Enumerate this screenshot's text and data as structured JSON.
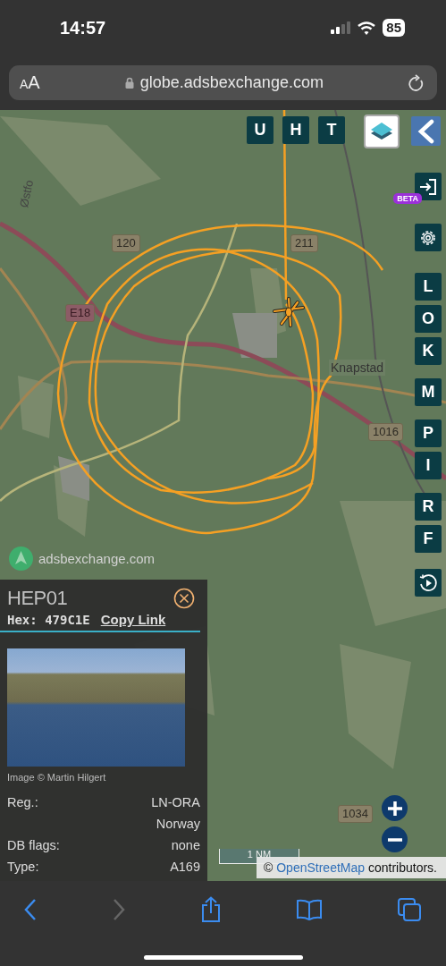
{
  "status_bar": {
    "time": "14:57",
    "battery": "85"
  },
  "browser": {
    "text_size_label": "AA",
    "url": "globe.adsbexchange.com"
  },
  "map": {
    "labels": [
      {
        "kind": "shield",
        "text": "120"
      },
      {
        "kind": "shield",
        "text": "211"
      },
      {
        "kind": "motorway",
        "text": "E18"
      },
      {
        "kind": "place",
        "text": "Knapstad"
      },
      {
        "kind": "shield",
        "text": "1016"
      },
      {
        "kind": "shield",
        "text": "1034"
      },
      {
        "kind": "vertical",
        "text": "Østfo"
      }
    ],
    "brand": "adsbexchange.com",
    "top_buttons": [
      "U",
      "H",
      "T"
    ],
    "beta_badge": "BETA",
    "side_button_groups": [
      [
        "L",
        "O",
        "K"
      ],
      [
        "M"
      ],
      [
        "P",
        "I"
      ],
      [
        "R",
        "F"
      ]
    ],
    "scale": "1 NM",
    "attribution": {
      "prefix": "©",
      "link": "OpenStreetMap",
      "suffix": "contributors."
    }
  },
  "aircraft_panel": {
    "callsign": "HEP01",
    "hex_label": "Hex:",
    "hex": "479C1E",
    "copy_link": "Copy Link",
    "photo_credit": "Image © Martin Hilgert",
    "rows": [
      {
        "label": "Reg.:",
        "value": "LN-ORA"
      },
      {
        "value": "Norway"
      },
      {
        "label": "DB flags:",
        "value": "none"
      },
      {
        "label": "Type:",
        "value": "A169"
      }
    ]
  }
}
